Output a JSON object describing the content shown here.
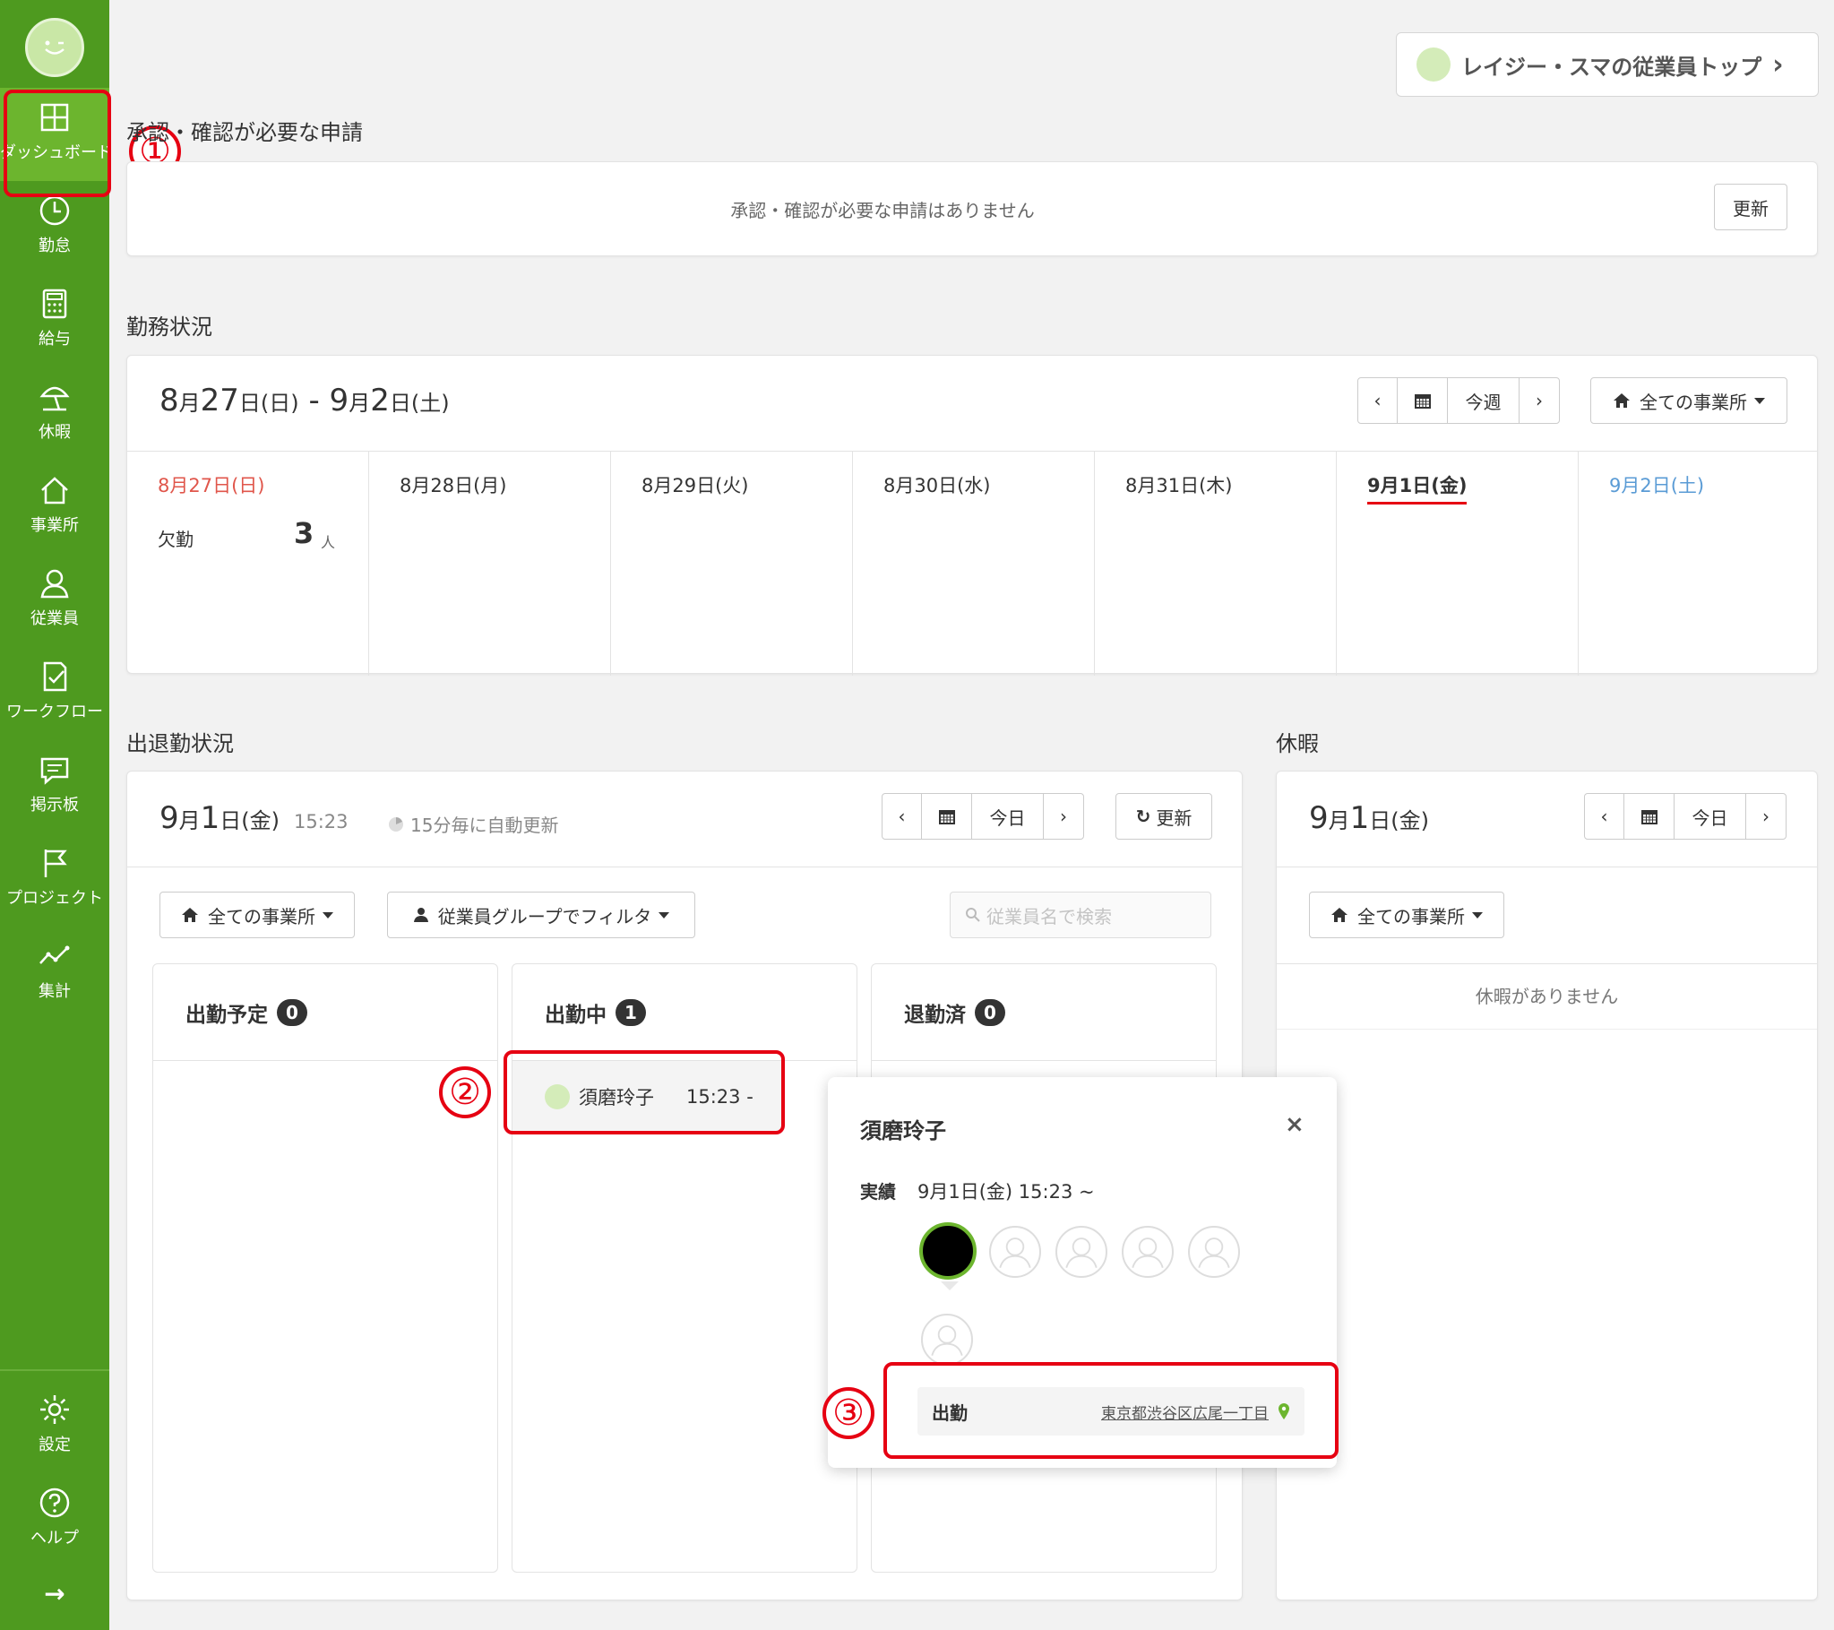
{
  "sidebar": {
    "items": [
      {
        "label": "ダッシュボード",
        "icon": "dashboard-icon"
      },
      {
        "label": "勤怠",
        "icon": "clock-icon"
      },
      {
        "label": "給与",
        "icon": "calculator-icon"
      },
      {
        "label": "休暇",
        "icon": "parasol-icon"
      },
      {
        "label": "事業所",
        "icon": "home-icon"
      },
      {
        "label": "従業員",
        "icon": "person-icon"
      },
      {
        "label": "ワークフロー",
        "icon": "checklist-icon"
      },
      {
        "label": "掲示板",
        "icon": "chat-icon"
      },
      {
        "label": "プロジェクト",
        "icon": "flag-icon"
      },
      {
        "label": "集計",
        "icon": "chart-line-icon"
      }
    ],
    "bottom": [
      {
        "label": "設定",
        "icon": "gear-icon"
      },
      {
        "label": "ヘルプ",
        "icon": "help-icon"
      }
    ],
    "collapse_arrow": "→",
    "accent": "#4e9a1f"
  },
  "top_link": {
    "label": "レイジー・スマの従業員トップ",
    "chevron": "›"
  },
  "approvals": {
    "title": "承認・確認が必要な申請",
    "empty": "承認・確認が必要な申請はありません",
    "refresh": "更新"
  },
  "work_status": {
    "title": "勤務状況",
    "range": {
      "m1": "8",
      "u1": "月",
      "d1": "27",
      "w1": "日(日)",
      "sep": "-",
      "m2": "9",
      "u2": "月",
      "d2": "2",
      "w2": "日(土)"
    },
    "prev": "‹",
    "next": "›",
    "today": "今週",
    "office": "全ての事業所",
    "days": [
      {
        "label": "8月27日(日)"
      },
      {
        "label": "8月28日(月)"
      },
      {
        "label": "8月29日(火)"
      },
      {
        "label": "8月30日(水)"
      },
      {
        "label": "8月31日(木)"
      },
      {
        "label": "9月1日(金)"
      },
      {
        "label": "9月2日(土)"
      }
    ],
    "absence_label": "欠勤",
    "absence_count": "3",
    "absence_unit": "人",
    "sunday_color": "#e0564b",
    "saturday_color": "#5a9bd5"
  },
  "attendance": {
    "title": "出退勤状況",
    "date": {
      "m": "9",
      "u": "月",
      "d": "1",
      "w": "日(金)"
    },
    "time": "15:23",
    "auto": "15分毎に自動更新",
    "today": "今日",
    "refresh": "更新",
    "office": "全ての事業所",
    "group_filter": "従業員グループでフィルタ",
    "search_placeholder": "従業員名で検索",
    "cols": [
      {
        "label": "出勤予定",
        "count": "0"
      },
      {
        "label": "出勤中",
        "count": "1"
      },
      {
        "label": "退勤済",
        "count": "0"
      }
    ],
    "employee": {
      "name": "須磨玲子",
      "time": "15:23 -"
    }
  },
  "popup": {
    "name": "須磨玲子",
    "close": "×",
    "record_label": "実績",
    "record_value": "9月1日(金) 15:23 ~",
    "punch_label": "出勤",
    "punch_location": "東京都渋谷区広尾一丁目"
  },
  "leave": {
    "title": "休暇",
    "date": {
      "m": "9",
      "u": "月",
      "d": "1",
      "w": "日(金)"
    },
    "today": "今日",
    "office": "全ての事業所",
    "empty": "休暇がありません"
  },
  "annotations": {
    "n1": "①",
    "n2": "②",
    "n3": "③"
  }
}
